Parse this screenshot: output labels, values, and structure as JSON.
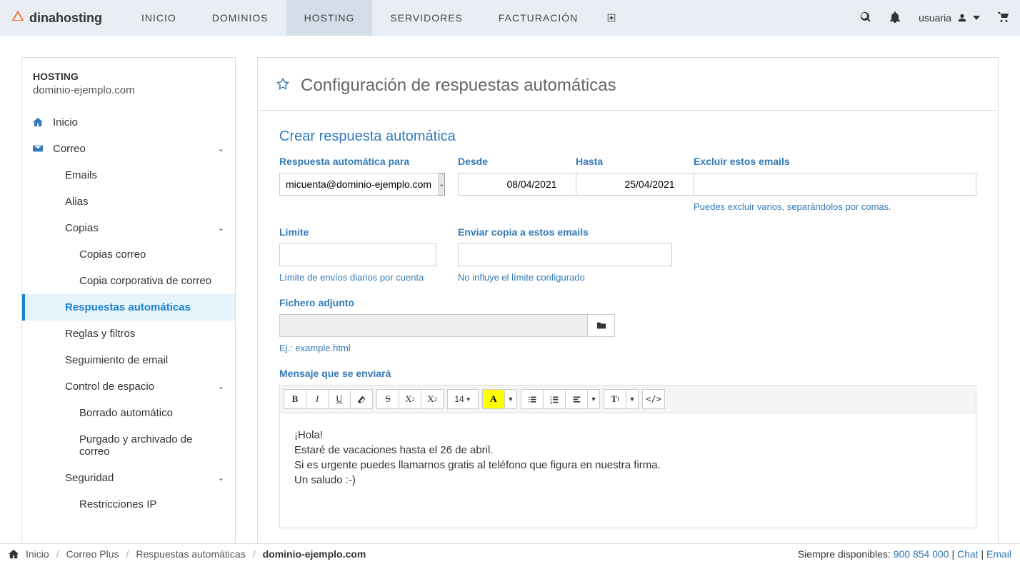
{
  "brand": "dinahosting",
  "nav": {
    "inicio": "Inicio",
    "dominios": "Dominios",
    "hosting": "Hosting",
    "servidores": "Servidores",
    "facturacion": "Facturación"
  },
  "user": "usuaria",
  "sidebar": {
    "title": "HOSTING",
    "domain": "dominio-ejemplo.com",
    "inicio": "Inicio",
    "correo": "Correo",
    "emails": "Emails",
    "alias": "Alias",
    "copias": "Copias",
    "copias_correo": "Copias correo",
    "copia_corp": "Copia corporativa de correo",
    "respuestas": "Respuestas automáticas",
    "reglas": "Reglas y filtros",
    "seguimiento": "Seguimiento de email",
    "control": "Control de espacio",
    "borrado": "Borrado automático",
    "purgado": "Purgado y archivado de correo",
    "seguridad": "Seguridad",
    "restricciones": "Restricciones IP"
  },
  "page": {
    "title": "Configuración de respuestas automáticas",
    "section": "Crear respuesta automática"
  },
  "form": {
    "para_label": "Respuesta automática para",
    "para_value": "micuenta@dominio-ejemplo.com",
    "desde_label": "Desde",
    "desde_value": "08/04/2021",
    "hasta_label": "Hasta",
    "hasta_value": "25/04/2021",
    "excluir_label": "Excluir estos emails",
    "excluir_help": "Puedes excluir varios, separándolos por comas.",
    "limite_label": "Límite",
    "limite_help": "Límite de envíos diarios por cuenta",
    "copia_label": "Enviar copia a estos emails",
    "copia_help": "No influye el límite configurado",
    "fichero_label": "Fichero adjunto",
    "fichero_help": "Ej.: example.html",
    "mensaje_label": "Mensaje que se enviará",
    "fontsize": "14",
    "message_l1": "¡Hola!",
    "message_l2": "Estaré de vacaciones hasta el 26 de abril.",
    "message_l3": "Si es urgente puedes llamarnos gratis al teléfono que figura en nuestra firma.",
    "message_l4": "Un saludo :-)"
  },
  "footer": {
    "inicio": "Inicio",
    "correo": "Correo Plus",
    "respuestas": "Respuestas automáticas",
    "domain": "dominio-ejemplo.com",
    "avail": "Siempre disponibles: ",
    "phone": "900 854 000",
    "chat": "Chat",
    "email": "Email"
  }
}
